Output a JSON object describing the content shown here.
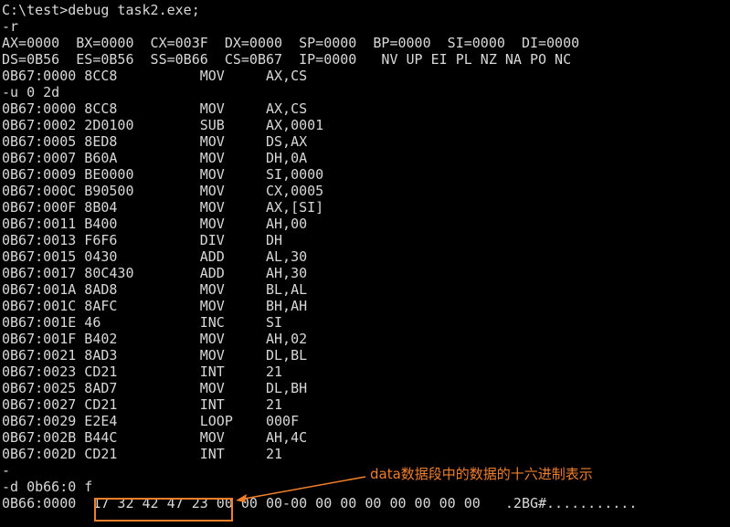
{
  "colors": {
    "background": "#000000",
    "text": "#d8d8d8",
    "annotation": "#f07f2a"
  },
  "console": {
    "lines": [
      "C:\\test>debug task2.exe;",
      "-r",
      "AX=0000  BX=0000  CX=003F  DX=0000  SP=0000  BP=0000  SI=0000  DI=0000",
      "DS=0B56  ES=0B56  SS=0B66  CS=0B67  IP=0000   NV UP EI PL NZ NA PO NC",
      "0B67:0000 8CC8          MOV     AX,CS",
      "-u 0 2d",
      "0B67:0000 8CC8          MOV     AX,CS",
      "0B67:0002 2D0100        SUB     AX,0001",
      "0B67:0005 8ED8          MOV     DS,AX",
      "0B67:0007 B60A          MOV     DH,0A",
      "0B67:0009 BE0000        MOV     SI,0000",
      "0B67:000C B90500        MOV     CX,0005",
      "0B67:000F 8B04          MOV     AX,[SI]",
      "0B67:0011 B400          MOV     AH,00",
      "0B67:0013 F6F6          DIV     DH",
      "0B67:0015 0430          ADD     AL,30",
      "0B67:0017 80C430        ADD     AH,30",
      "0B67:001A 8AD8          MOV     BL,AL",
      "0B67:001C 8AFC          MOV     BH,AH",
      "0B67:001E 46            INC     SI",
      "0B67:001F B402          MOV     AH,02",
      "0B67:0021 8AD3          MOV     DL,BL",
      "0B67:0023 CD21          INT     21",
      "0B67:0025 8AD7          MOV     DL,BH",
      "0B67:0027 CD21          INT     21",
      "0B67:0029 E2E4          LOOP    000F",
      "0B67:002B B44C          MOV     AH,4C",
      "0B67:002D CD21          INT     21",
      "-",
      "-d 0b66:0 f",
      "0B66:0000  17 32 42 47 23 00 00 00-00 00 00 00 00 00 00 00   .2BG#..........."
    ]
  },
  "annotation": {
    "label": "data数据段中的数据的十六进制表示"
  }
}
